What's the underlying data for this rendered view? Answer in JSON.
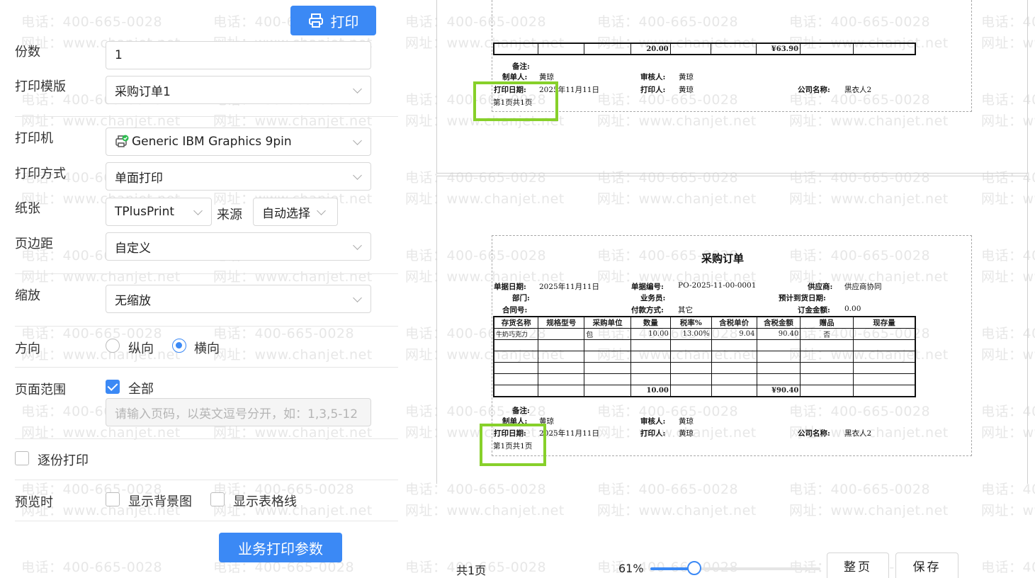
{
  "watermark": {
    "phone": "电话：400-665-0028",
    "site": "网址：www.chanjet.net"
  },
  "toolbar": {
    "print_label": "打印",
    "print_icon": "printer-icon"
  },
  "settings": {
    "copies_label": "份数",
    "copies_value": "1",
    "template_label": "打印模版",
    "template_value": "采购订单1",
    "printer_label": "打印机",
    "printer_value": "Generic IBM Graphics 9pin",
    "printer_icon": "printer-ok-icon",
    "mode_label": "打印方式",
    "mode_value": "单面打印",
    "paper_label": "纸张",
    "paper_value": "TPlusPrint",
    "source_label": "来源",
    "source_value": "自动选择",
    "margin_label": "页边距",
    "margin_value": "自定义",
    "scale_label": "缩放",
    "scale_value": "无缩放",
    "orientation_label": "方向",
    "portrait_label": "纵向",
    "landscape_label": "横向",
    "orientation_selected": "横向",
    "range_label": "页面范围",
    "range_all_label": "全部",
    "range_placeholder": "请输入页码，以英文逗号分开，如：1,3,5-12",
    "collate_label": "逐份打印",
    "preview_label": "预览时",
    "show_bg_label": "显示背景图",
    "show_grid_label": "显示表格线",
    "biz_params_label": "业务打印参数"
  },
  "doc": {
    "title": "采购订单",
    "bill_date_label": "单据日期:",
    "bill_date": "2025年11月11日",
    "bill_no_label": "单据编号:",
    "bill_no": "PO-2025-11-00-0001",
    "supplier_label": "供应商:",
    "supplier": "供应商协同",
    "dept_label": "部门:",
    "salesman_label": "业务员:",
    "arrival_label": "预计到货日期:",
    "contract_label": "合同号:",
    "paytype_label": "付款方式:",
    "paytype": "其它",
    "deposit_label": "订金金额:",
    "deposit": "0.00",
    "headers": [
      "存货名称",
      "规格型号",
      "采购单位",
      "数量",
      "税率%",
      "含税单价",
      "含税金额",
      "赠品",
      "现存量"
    ],
    "row": [
      "牛奶巧克力",
      "",
      "包",
      "10.00",
      "13.00%",
      "9.04",
      "90.40",
      "否",
      ""
    ],
    "total_qty": "10.00",
    "total_amount": "¥90.40",
    "prev_total_qty": "20.00",
    "prev_total_amount": "¥63.90",
    "remark_label": "备注:",
    "maker_label": "制单人:",
    "maker": "黄琼",
    "auditor_label": "审核人:",
    "auditor": "黄琼",
    "print_date_label": "打印日期:",
    "print_date": "2025年11月11日",
    "printer_person_label": "打印人:",
    "printer_person": "黄琼",
    "company_label": "公司名称:",
    "company": "黑衣人2",
    "page_info": "第1页共1页"
  },
  "footer": {
    "pages_text": "共1页",
    "zoom_text": "61%",
    "zoom_value": 0.26,
    "fit_label": "整页",
    "save_label": "保存"
  }
}
